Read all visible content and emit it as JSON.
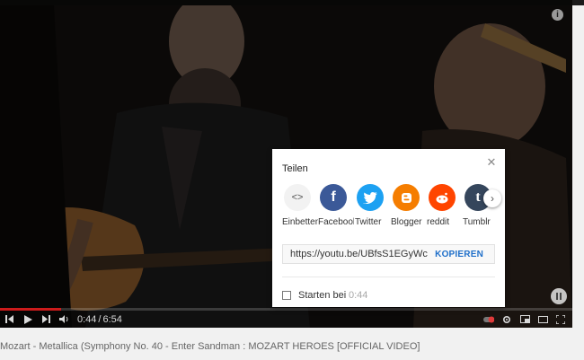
{
  "player": {
    "time_current": "0:44",
    "time_separator": "/",
    "time_total": "6:54",
    "progress_fraction": 0.106
  },
  "video_title": "Mozart - Metallica (Symphony No. 40 - Enter Sandman : MOZART HEROES [OFFICIAL VIDEO]",
  "share": {
    "title": "Teilen",
    "targets": [
      {
        "label": "Einbetten",
        "icon": "embed-icon",
        "glyph": "<>",
        "color": "#f2f2f2",
        "fg": "#555555"
      },
      {
        "label": "Facebook",
        "icon": "facebook-icon",
        "glyph": "f",
        "color": "#3b5998",
        "fg": "#ffffff"
      },
      {
        "label": "Twitter",
        "icon": "twitter-icon",
        "glyph": "t",
        "color": "#1da1f2",
        "fg": "#ffffff"
      },
      {
        "label": "Blogger",
        "icon": "blogger-icon",
        "glyph": "B",
        "color": "#f57d00",
        "fg": "#ffffff"
      },
      {
        "label": "reddit",
        "icon": "reddit-icon",
        "glyph": "r",
        "color": "#ff4500",
        "fg": "#ffffff"
      },
      {
        "label": "Tumblr",
        "icon": "tumblr-icon",
        "glyph": "t",
        "color": "#35465c",
        "fg": "#ffffff"
      }
    ],
    "url": "https://youtu.be/UBfsS1EGyWc",
    "copy_label": "KOPIEREN",
    "start_label": "Starten bei",
    "start_time": "0:44"
  },
  "colors": {
    "accent": "#cc1b1b",
    "copy_link": "#1f6fc9"
  }
}
